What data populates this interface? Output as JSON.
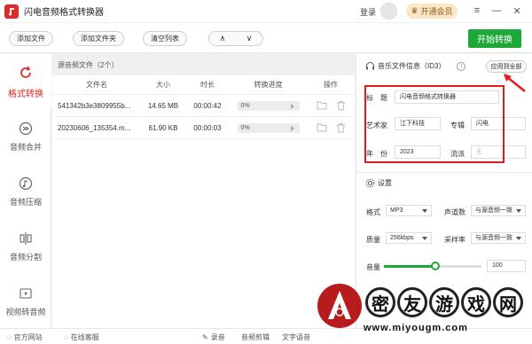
{
  "app": {
    "title": "闪电音频格式转换器"
  },
  "header": {
    "login": "登录",
    "vip": "开通会员"
  },
  "toolbar": {
    "add_file": "添加文件",
    "add_folder": "添加文件夹",
    "clear_list": "清空列表",
    "up": "∧",
    "down": "∨",
    "start": "开始转换"
  },
  "sidebar": {
    "items": [
      {
        "label": "格式转换"
      },
      {
        "label": "音频合并"
      },
      {
        "label": "音频压缩"
      },
      {
        "label": "音频分割"
      },
      {
        "label": "视频转音频"
      }
    ]
  },
  "filelist": {
    "title": "源音频文件（2个）",
    "columns": [
      "文件名",
      "大小",
      "时长",
      "转换进度",
      "操作"
    ],
    "rows": [
      {
        "name": "541342b3e3809955b...",
        "size": "14.65 MB",
        "duration": "00:00:42",
        "progress": "0%"
      },
      {
        "name": "20230606_135354.m...",
        "size": "61.90 KB",
        "duration": "00:00:03",
        "progress": "0%"
      }
    ]
  },
  "id3": {
    "title": "音乐文件信息（ID3）",
    "apply_all": "应用到全部",
    "labels": {
      "title": "标　题",
      "artist": "艺术家",
      "album": "专辑",
      "year": "年　份",
      "genre": "流派"
    },
    "values": {
      "title": "闪电音频格式转换器",
      "artist": "江下科技",
      "album": "闪电",
      "year": "2023",
      "genre": "无"
    }
  },
  "settings": {
    "title": "设置",
    "format_label": "格式",
    "format": "MP3",
    "channels_label": "声道数",
    "channels": "与源音频一致",
    "quality_label": "质量",
    "quality": "256kbps",
    "samplerate_label": "采样率",
    "samplerate": "与源音频一致",
    "volume_label": "音量",
    "volume": "100"
  },
  "bottom": {
    "website": "官方网站",
    "service": "在线客服",
    "record": "录音",
    "edit": "音频剪辑",
    "tts": "文字语音"
  },
  "watermark": {
    "chars": [
      "密",
      "友",
      "游",
      "戏",
      "网"
    ],
    "url": "www.miyougm.com"
  },
  "colors": {
    "accent": "#e02a2a",
    "green": "#1fa83a",
    "highlight": "#e21b1b"
  }
}
